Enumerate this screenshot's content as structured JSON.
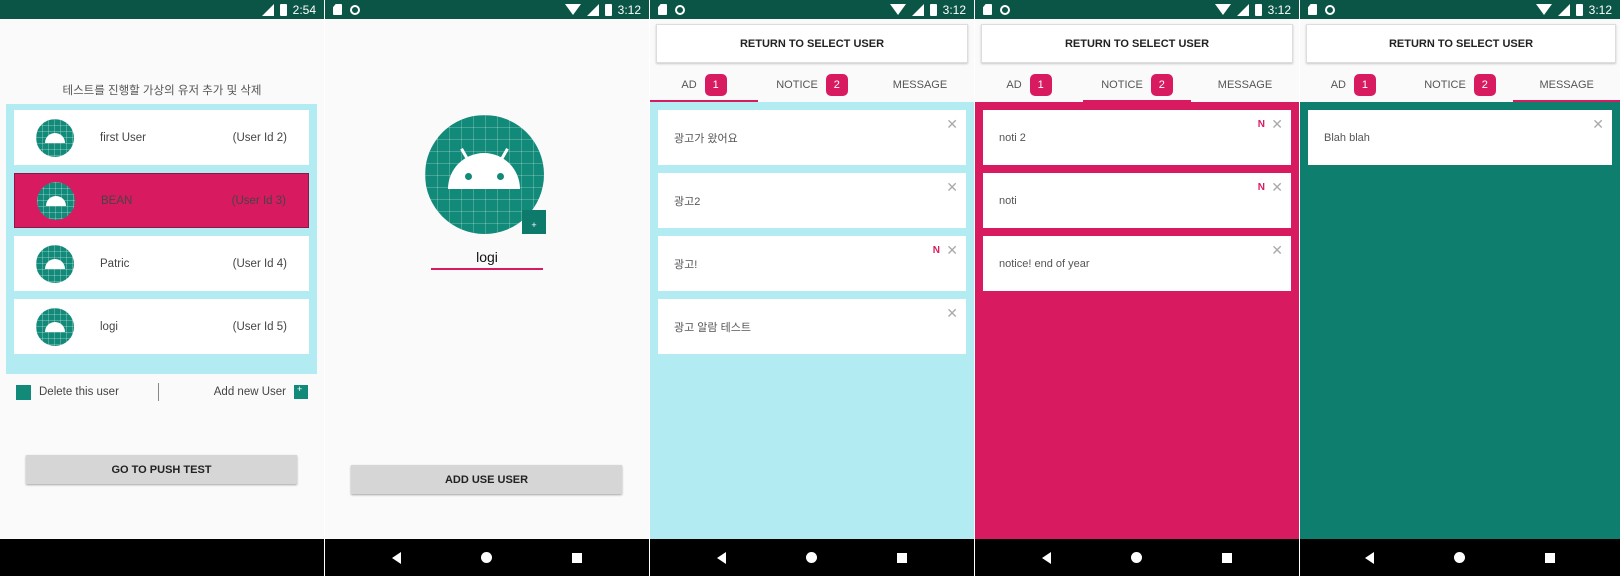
{
  "colors": {
    "teal": "#128a7a",
    "pink": "#d81b60",
    "light_blue": "#b2ebf2",
    "status_bar": "#0b5547"
  },
  "screen1": {
    "time": "2:54",
    "heading": "테스트를 진행할 가상의 유저 추가 및 삭제",
    "users": [
      {
        "name": "first User",
        "id": "(User Id 2)"
      },
      {
        "name": "BEAN",
        "id": "(User Id 3)"
      },
      {
        "name": "Patric",
        "id": "(User Id 4)"
      },
      {
        "name": "logi",
        "id": "(User Id 5)"
      }
    ],
    "delete_label": "Delete this user",
    "add_label": "Add new User",
    "push_button": "GO TO PUSH TEST"
  },
  "screen2": {
    "time": "3:12",
    "name_value": "logi",
    "add_photo": "+",
    "add_button": "ADD USE USER"
  },
  "feed_common": {
    "time": "3:12",
    "return_button": "RETURN TO SELECT USER",
    "tabs": [
      {
        "label": "AD",
        "badge": "1"
      },
      {
        "label": "NOTICE",
        "badge": "2"
      },
      {
        "label": "MESSAGE"
      }
    ],
    "new_mark": "N",
    "close_glyph": "✕"
  },
  "ad_items": [
    "광고가 왔어요",
    "광고2",
    "광고!",
    "광고 알람 테스트"
  ],
  "notice_items": [
    "noti 2",
    "noti",
    "notice! end of year"
  ],
  "message_items": [
    "Blah blah"
  ]
}
